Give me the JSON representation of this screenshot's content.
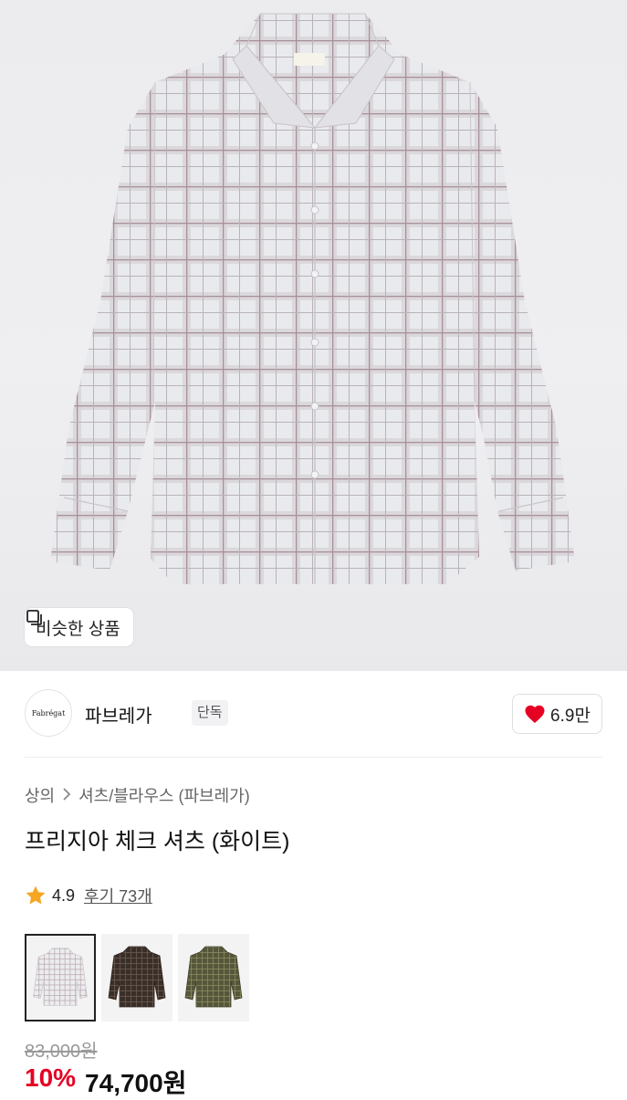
{
  "product": {
    "similar_label": "비슷한 상품",
    "brand": {
      "logo_text": "Fabrégat",
      "name": "파브레가",
      "badge": "단독"
    },
    "likes": "6.9만",
    "breadcrumb": [
      "상의",
      "셔츠/블라우스 (파브레가)"
    ],
    "title": "프리지아 체크 셔츠 (화이트)",
    "rating": "4.9",
    "reviews": "후기 73개",
    "color_options": [
      "white-check",
      "brown-check",
      "olive-check"
    ],
    "original_price": "83,000원",
    "discount": "10%",
    "price": "74,700원"
  },
  "colors": {
    "discount_red": "#e60023",
    "heart_red": "#e60023",
    "star_orange": "#f5a623"
  },
  "icons": [
    "copy-icon",
    "heart-icon",
    "chevron-right-icon",
    "star-icon"
  ]
}
